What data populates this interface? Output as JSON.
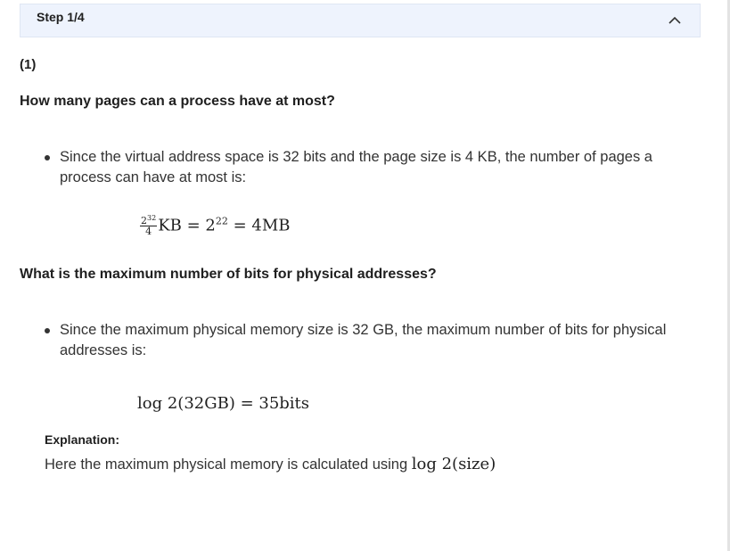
{
  "step": {
    "title": "Step 1/4",
    "toggle_icon": "chevron-up-icon"
  },
  "part_label": "(1)",
  "section1": {
    "question": "How many pages can a process have at most?",
    "bullet": "Since the virtual address space is 32 bits and the page size is 4 KB, the number of pages a process can have at most is:",
    "equation": {
      "numerator_base": "2",
      "numerator_exp": "32",
      "denominator": "4",
      "unit": "KB",
      "eq1": " = 2",
      "exp2": "22",
      "eq2": " = 4MB"
    }
  },
  "section2": {
    "question": "What is the maximum number of bits for physical addresses?",
    "bullet": "Since the maximum physical memory size is 32 GB, the maximum number of bits for physical addresses is:",
    "equation": "log 2(32GB) = 35bits"
  },
  "explanation": {
    "label": "Explanation:",
    "text": "Here the maximum physical memory is calculated using ",
    "math": "log 2(size)"
  }
}
